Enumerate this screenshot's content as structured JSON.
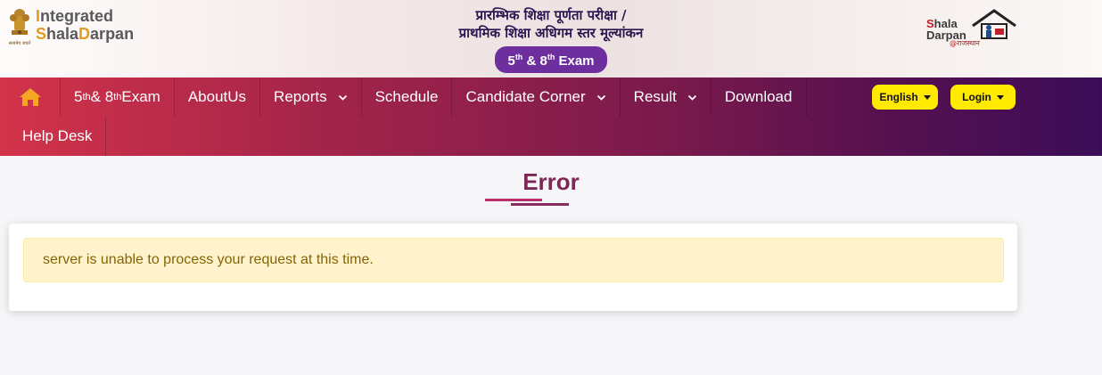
{
  "header": {
    "logo_left": {
      "line1_first": "I",
      "line1_rest": "ntegrated",
      "line2_first": "S",
      "line2_mid": "hala",
      "line2_d": "D",
      "line2_rest": "arpan"
    },
    "title_line1": "प्रारम्भिक शिक्षा पूर्णता परीक्षा /",
    "title_line2": "प्राथमिक शिक्षा अधिगम स्तर मूल्यांकन",
    "exam_badge": {
      "num1": "5",
      "sup1": "th",
      "mid": " & ",
      "num2": "8",
      "sup2": "th",
      "rest": " Exam"
    },
    "logo_right": {
      "s": "S",
      "hala": "hala",
      "darpan": "Darpan",
      "rajasthan": "@राजस्थान"
    }
  },
  "navbar": {
    "home_icon": "home-icon",
    "items": [
      {
        "label": "5",
        "sup": "th",
        "label2": " & 8",
        "sup2": "th",
        "label3": " Exam"
      },
      {
        "label": "AboutUs"
      },
      {
        "label": "Reports"
      },
      {
        "label": "Schedule"
      },
      {
        "label": "Candidate Corner"
      },
      {
        "label": "Result"
      },
      {
        "label": "Download"
      },
      {
        "label": "Help Desk"
      }
    ],
    "language_button": "English",
    "login_button": "Login"
  },
  "main": {
    "title": "Error",
    "alert_text": "server is unable to process your request at this time."
  },
  "colors": {
    "nav_start": "#d3334a",
    "nav_end": "#3b0d58",
    "accent_yellow": "#ffea00",
    "title": "#7d2855",
    "alert_bg": "#fff3cd",
    "alert_text": "#856404",
    "badge": "#6e2f9e"
  }
}
